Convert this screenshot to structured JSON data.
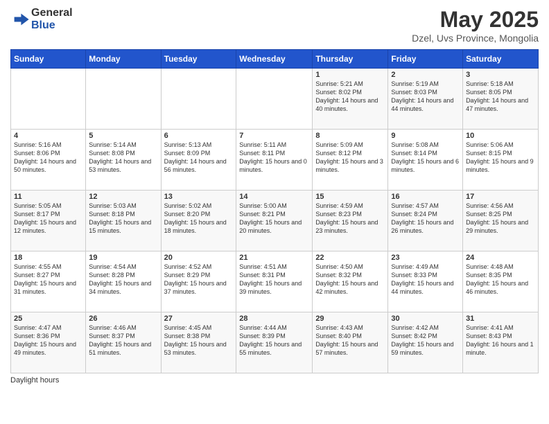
{
  "header": {
    "logo_general": "General",
    "logo_blue": "Blue",
    "main_title": "May 2025",
    "subtitle": "Dzel, Uvs Province, Mongolia"
  },
  "calendar": {
    "days_of_week": [
      "Sunday",
      "Monday",
      "Tuesday",
      "Wednesday",
      "Thursday",
      "Friday",
      "Saturday"
    ],
    "weeks": [
      [
        {
          "day": "",
          "info": ""
        },
        {
          "day": "",
          "info": ""
        },
        {
          "day": "",
          "info": ""
        },
        {
          "day": "",
          "info": ""
        },
        {
          "day": "1",
          "info": "Sunrise: 5:21 AM\nSunset: 8:02 PM\nDaylight: 14 hours and 40 minutes."
        },
        {
          "day": "2",
          "info": "Sunrise: 5:19 AM\nSunset: 8:03 PM\nDaylight: 14 hours and 44 minutes."
        },
        {
          "day": "3",
          "info": "Sunrise: 5:18 AM\nSunset: 8:05 PM\nDaylight: 14 hours and 47 minutes."
        }
      ],
      [
        {
          "day": "4",
          "info": "Sunrise: 5:16 AM\nSunset: 8:06 PM\nDaylight: 14 hours and 50 minutes."
        },
        {
          "day": "5",
          "info": "Sunrise: 5:14 AM\nSunset: 8:08 PM\nDaylight: 14 hours and 53 minutes."
        },
        {
          "day": "6",
          "info": "Sunrise: 5:13 AM\nSunset: 8:09 PM\nDaylight: 14 hours and 56 minutes."
        },
        {
          "day": "7",
          "info": "Sunrise: 5:11 AM\nSunset: 8:11 PM\nDaylight: 15 hours and 0 minutes."
        },
        {
          "day": "8",
          "info": "Sunrise: 5:09 AM\nSunset: 8:12 PM\nDaylight: 15 hours and 3 minutes."
        },
        {
          "day": "9",
          "info": "Sunrise: 5:08 AM\nSunset: 8:14 PM\nDaylight: 15 hours and 6 minutes."
        },
        {
          "day": "10",
          "info": "Sunrise: 5:06 AM\nSunset: 8:15 PM\nDaylight: 15 hours and 9 minutes."
        }
      ],
      [
        {
          "day": "11",
          "info": "Sunrise: 5:05 AM\nSunset: 8:17 PM\nDaylight: 15 hours and 12 minutes."
        },
        {
          "day": "12",
          "info": "Sunrise: 5:03 AM\nSunset: 8:18 PM\nDaylight: 15 hours and 15 minutes."
        },
        {
          "day": "13",
          "info": "Sunrise: 5:02 AM\nSunset: 8:20 PM\nDaylight: 15 hours and 18 minutes."
        },
        {
          "day": "14",
          "info": "Sunrise: 5:00 AM\nSunset: 8:21 PM\nDaylight: 15 hours and 20 minutes."
        },
        {
          "day": "15",
          "info": "Sunrise: 4:59 AM\nSunset: 8:23 PM\nDaylight: 15 hours and 23 minutes."
        },
        {
          "day": "16",
          "info": "Sunrise: 4:57 AM\nSunset: 8:24 PM\nDaylight: 15 hours and 26 minutes."
        },
        {
          "day": "17",
          "info": "Sunrise: 4:56 AM\nSunset: 8:25 PM\nDaylight: 15 hours and 29 minutes."
        }
      ],
      [
        {
          "day": "18",
          "info": "Sunrise: 4:55 AM\nSunset: 8:27 PM\nDaylight: 15 hours and 31 minutes."
        },
        {
          "day": "19",
          "info": "Sunrise: 4:54 AM\nSunset: 8:28 PM\nDaylight: 15 hours and 34 minutes."
        },
        {
          "day": "20",
          "info": "Sunrise: 4:52 AM\nSunset: 8:29 PM\nDaylight: 15 hours and 37 minutes."
        },
        {
          "day": "21",
          "info": "Sunrise: 4:51 AM\nSunset: 8:31 PM\nDaylight: 15 hours and 39 minutes."
        },
        {
          "day": "22",
          "info": "Sunrise: 4:50 AM\nSunset: 8:32 PM\nDaylight: 15 hours and 42 minutes."
        },
        {
          "day": "23",
          "info": "Sunrise: 4:49 AM\nSunset: 8:33 PM\nDaylight: 15 hours and 44 minutes."
        },
        {
          "day": "24",
          "info": "Sunrise: 4:48 AM\nSunset: 8:35 PM\nDaylight: 15 hours and 46 minutes."
        }
      ],
      [
        {
          "day": "25",
          "info": "Sunrise: 4:47 AM\nSunset: 8:36 PM\nDaylight: 15 hours and 49 minutes."
        },
        {
          "day": "26",
          "info": "Sunrise: 4:46 AM\nSunset: 8:37 PM\nDaylight: 15 hours and 51 minutes."
        },
        {
          "day": "27",
          "info": "Sunrise: 4:45 AM\nSunset: 8:38 PM\nDaylight: 15 hours and 53 minutes."
        },
        {
          "day": "28",
          "info": "Sunrise: 4:44 AM\nSunset: 8:39 PM\nDaylight: 15 hours and 55 minutes."
        },
        {
          "day": "29",
          "info": "Sunrise: 4:43 AM\nSunset: 8:40 PM\nDaylight: 15 hours and 57 minutes."
        },
        {
          "day": "30",
          "info": "Sunrise: 4:42 AM\nSunset: 8:42 PM\nDaylight: 15 hours and 59 minutes."
        },
        {
          "day": "31",
          "info": "Sunrise: 4:41 AM\nSunset: 8:43 PM\nDaylight: 16 hours and 1 minute."
        }
      ]
    ]
  },
  "footer": {
    "daylight_hours": "Daylight hours"
  }
}
